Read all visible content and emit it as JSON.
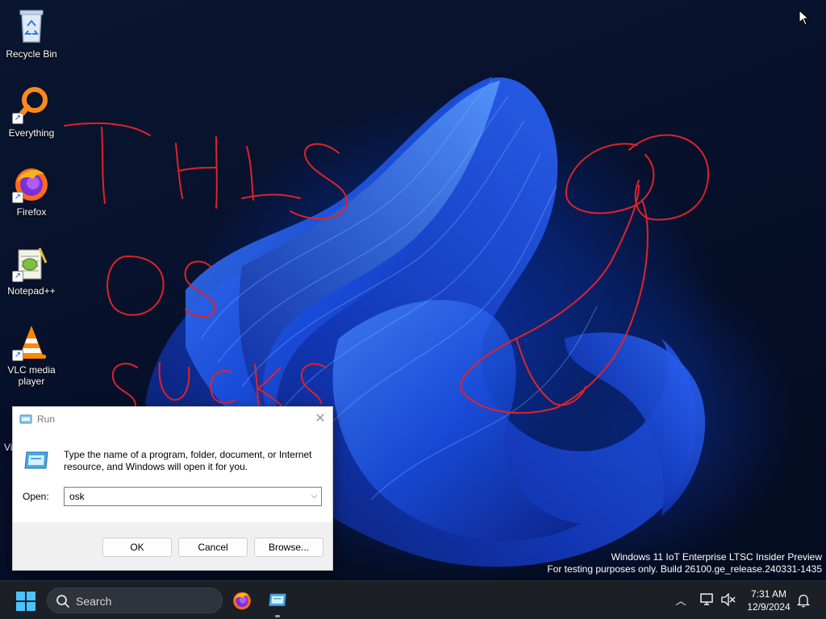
{
  "desktop": {
    "icons": [
      {
        "label": "Recycle Bin",
        "icon": "recycle-bin-icon"
      },
      {
        "label": "Everything",
        "icon": "everything-search-icon"
      },
      {
        "label": "Firefox",
        "icon": "firefox-icon"
      },
      {
        "label": "Notepad++",
        "icon": "notepad-plus-plus-icon"
      },
      {
        "label": "VLC media player",
        "icon": "vlc-icon"
      }
    ],
    "partial_icon_label": "Vi",
    "scribble_text": "THIS OS SUCKS",
    "watermark": {
      "line1": "Windows 11 IoT Enterprise LTSC Insider Preview",
      "line2": "For testing purposes only. Build 26100.ge_release.240331-1435"
    }
  },
  "run_dialog": {
    "title": "Run",
    "description": "Type the name of a program, folder, document, or Internet resource, and Windows will open it for you.",
    "open_label": "Open:",
    "open_value": "osk",
    "buttons": {
      "ok": "OK",
      "cancel": "Cancel",
      "browse": "Browse..."
    }
  },
  "taskbar": {
    "search_placeholder": "Search",
    "pinned": [
      "firefox-icon",
      "run-icon"
    ],
    "clock": {
      "time": "7:31 AM",
      "date": "12/9/2024"
    }
  },
  "colors": {
    "accent": "#4cc2ff",
    "scribble": "#e0222a",
    "taskbar": "#1c1f26"
  }
}
